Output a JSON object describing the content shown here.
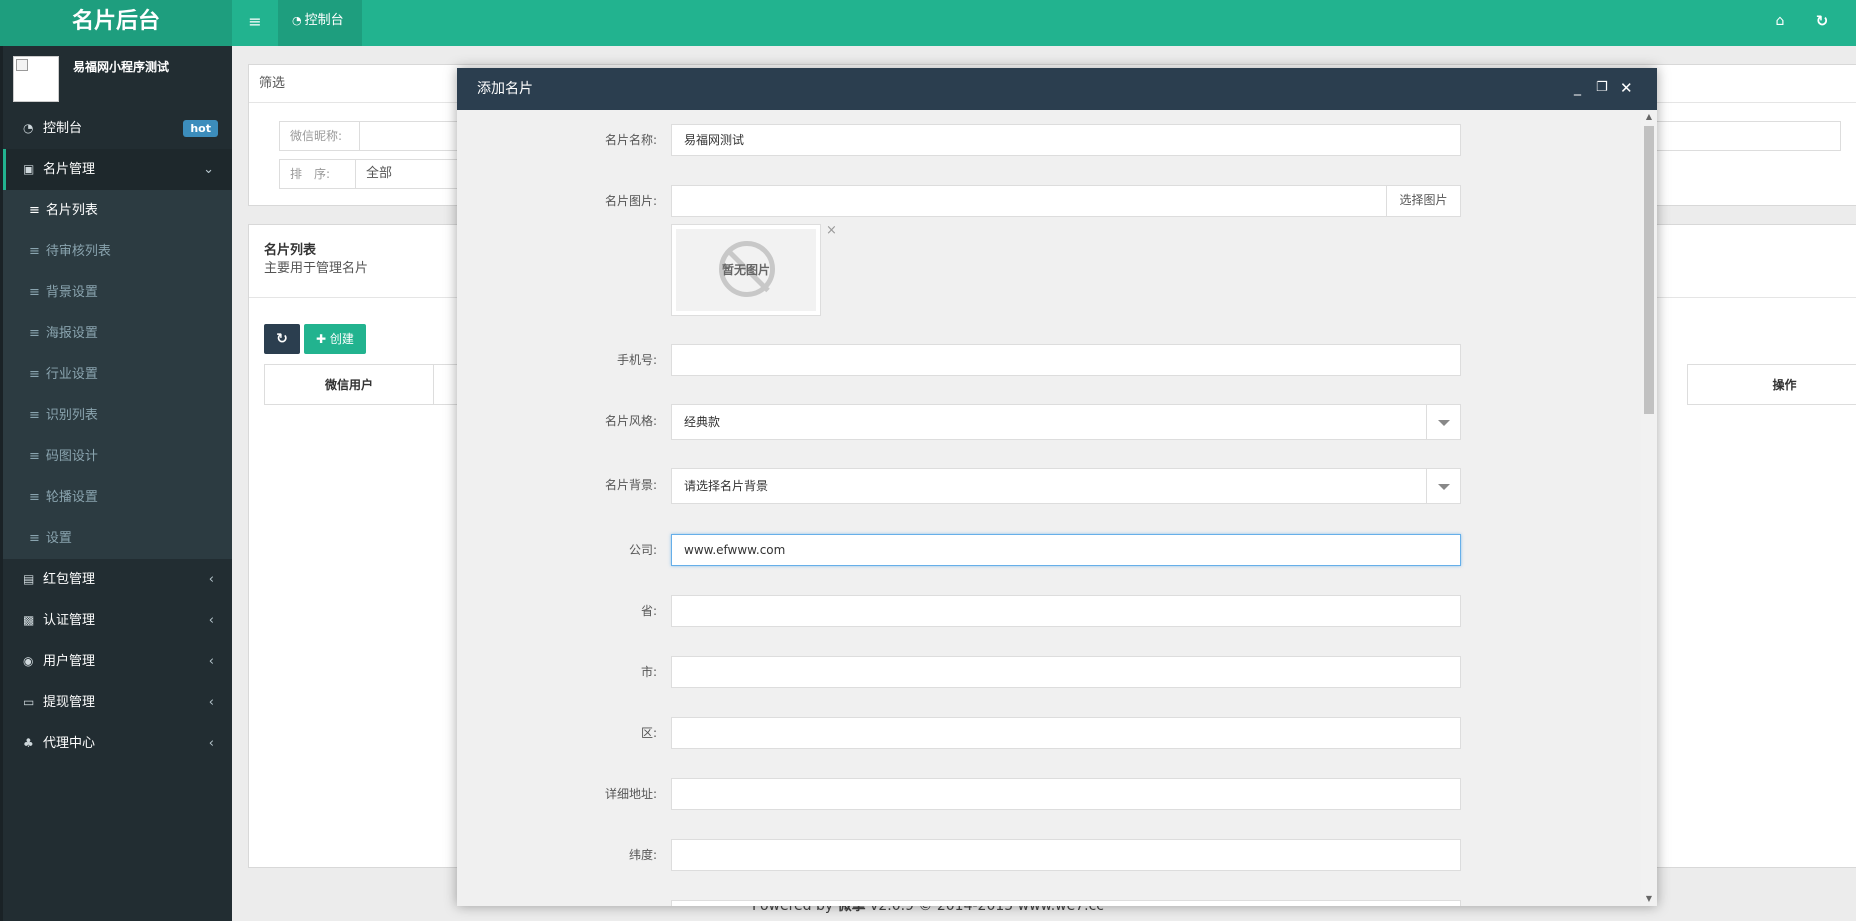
{
  "app": {
    "brand": "名片后台"
  },
  "topbar": {
    "tab_label": "控制台"
  },
  "sidebar": {
    "user_name": "易福网小程序测试",
    "dashboard": {
      "label": "控制台",
      "badge": "hot"
    },
    "card_mgmt": "名片管理",
    "sub_items": [
      "名片列表",
      "待审核列表",
      "背景设置",
      "海报设置",
      "行业设置",
      "识别列表",
      "码图设计",
      "轮播设置",
      "设置"
    ],
    "groups": [
      "红包管理",
      "认证管理",
      "用户管理",
      "提现管理",
      "代理中心"
    ]
  },
  "filter": {
    "title": "筛选",
    "nickname_label": "微信昵称:",
    "sort_label": "排　序:",
    "sort_value": "全部"
  },
  "list": {
    "title": "名片列表",
    "subtitle": "主要用于管理名片",
    "create_label": "创建",
    "columns": {
      "first": "微信用户",
      "last": "操作"
    }
  },
  "footer": {
    "prefix": "Powered by ",
    "brand": "微擎",
    "suffix": " v2.0.9 © 2014-2015 www.we7.cc"
  },
  "modal": {
    "title": "添加名片",
    "fields": {
      "name": {
        "label": "名片名称:",
        "value": "易福网测试"
      },
      "image": {
        "label": "名片图片:",
        "value": "",
        "button": "选择图片",
        "placeholder_text": "暂无图片"
      },
      "phone": {
        "label": "手机号:",
        "value": ""
      },
      "style": {
        "label": "名片风格:",
        "value": "经典款"
      },
      "background": {
        "label": "名片背景:",
        "value": "请选择名片背景"
      },
      "company": {
        "label": "公司:",
        "value": "www.efwww.com"
      },
      "province": {
        "label": "省:",
        "value": ""
      },
      "city": {
        "label": "市:",
        "value": ""
      },
      "district": {
        "label": "区:",
        "value": ""
      },
      "address": {
        "label": "详细地址:",
        "value": ""
      },
      "latitude": {
        "label": "纬度:",
        "value": ""
      }
    }
  },
  "colors": {
    "primary": "#22b38f",
    "dark": "#2b3e4f",
    "sidebar": "#222d32",
    "badge": "#3c8dbc"
  }
}
